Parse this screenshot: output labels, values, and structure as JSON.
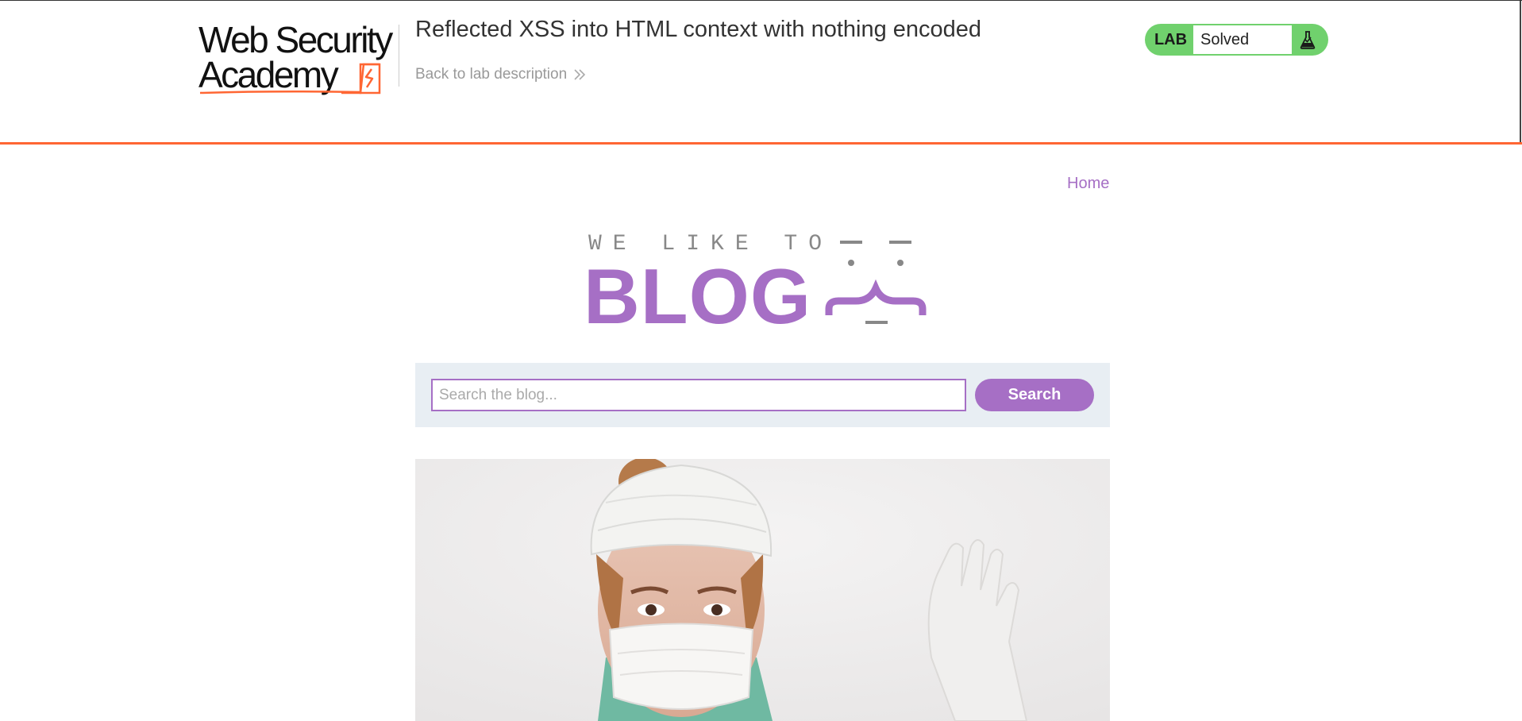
{
  "header": {
    "logo_line1": "Web Security",
    "logo_line2": "Academy",
    "lab_title": "Reflected XSS into HTML context with nothing encoded",
    "back_link": "Back to lab description",
    "status": {
      "tag": "LAB",
      "state": "Solved",
      "icon": "flask-icon",
      "color": "#70d16d"
    },
    "accent_color": "#ff6633"
  },
  "nav": {
    "home": "Home"
  },
  "blog_logo": {
    "tagline": "WE LIKE TO",
    "word": "BLOG",
    "color": "#a66fc5"
  },
  "search": {
    "placeholder": "Search the blog...",
    "value": "",
    "button_label": "Search"
  },
  "post": {
    "image_icon": "surgeon-photo"
  }
}
